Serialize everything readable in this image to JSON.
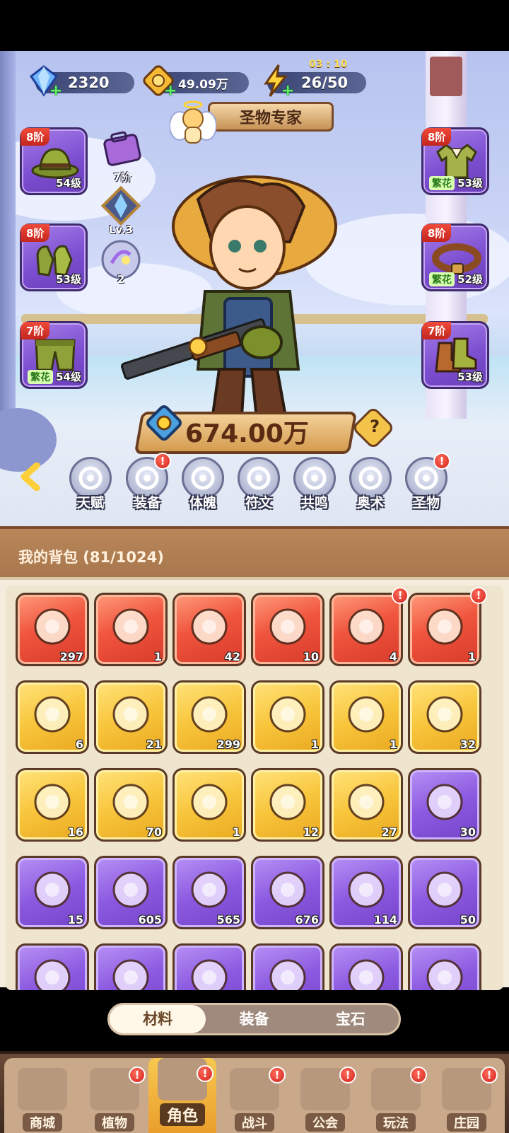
{
  "resources": {
    "gems": "2320",
    "coins": "49.09万",
    "energy": "26/50",
    "energy_timer": "03 : 10"
  },
  "title_banner": "圣物专家",
  "left_slots": [
    {
      "tier": "8阶",
      "level": "54级",
      "tag": "",
      "icon": "hat-icon"
    },
    {
      "tier": "8阶",
      "level": "53级",
      "tag": "",
      "icon": "gloves-icon"
    },
    {
      "tier": "7阶",
      "level": "54级",
      "tag": "繁花",
      "icon": "pants-icon"
    }
  ],
  "right_slots": [
    {
      "tier": "8阶",
      "level": "53级",
      "tag": "繁花",
      "icon": "shirt-icon"
    },
    {
      "tier": "8阶",
      "level": "52级",
      "tag": "繁花",
      "icon": "belt-icon"
    },
    {
      "tier": "7阶",
      "level": "53级",
      "tag": "",
      "icon": "boots-icon"
    }
  ],
  "mini": {
    "bag_label": "7阶",
    "crystal_label": "Lv.3",
    "orb_label": "2"
  },
  "power": "674.00万",
  "features": [
    {
      "label": "天赋",
      "alert": false
    },
    {
      "label": "装备",
      "alert": true
    },
    {
      "label": "体魄",
      "alert": false
    },
    {
      "label": "符文",
      "alert": false
    },
    {
      "label": "共鸣",
      "alert": false
    },
    {
      "label": "奥术",
      "alert": false
    },
    {
      "label": "圣物",
      "alert": true
    }
  ],
  "backpack": {
    "title": "我的背包 (81/1024)",
    "items": [
      {
        "rarity": "red",
        "count": "297",
        "icon": "star-crystal-icon",
        "alert": false
      },
      {
        "rarity": "red",
        "count": "1",
        "icon": "moon-crystal-icon",
        "alert": false
      },
      {
        "rarity": "red",
        "count": "42",
        "icon": "red-potion-icon",
        "alert": false
      },
      {
        "rarity": "red",
        "count": "10",
        "icon": "green-capsule-icon",
        "alert": false
      },
      {
        "rarity": "red",
        "count": "4",
        "icon": "green-vial-icon",
        "alert": true
      },
      {
        "rarity": "red",
        "count": "1",
        "icon": "mystery-chest-icon",
        "alert": true
      },
      {
        "rarity": "gold",
        "count": "6",
        "icon": "key-icon",
        "alert": false
      },
      {
        "rarity": "gold",
        "count": "21",
        "icon": "prism-icon",
        "alert": false
      },
      {
        "rarity": "gold",
        "count": "299",
        "icon": "orange-potion-icon",
        "alert": false
      },
      {
        "rarity": "gold",
        "count": "1",
        "icon": "gold-pile-icon",
        "alert": false
      },
      {
        "rarity": "gold",
        "count": "1",
        "icon": "flower-pot-icon",
        "alert": false
      },
      {
        "rarity": "gold",
        "count": "32",
        "icon": "spell-book-icon",
        "alert": false
      },
      {
        "rarity": "gold",
        "count": "16",
        "icon": "can-icon",
        "alert": false
      },
      {
        "rarity": "gold",
        "count": "70",
        "icon": "owl-sack-icon",
        "alert": false
      },
      {
        "rarity": "gold",
        "count": "1",
        "icon": "thread-spool-icon",
        "alert": false
      },
      {
        "rarity": "gold",
        "count": "12",
        "icon": "glow-flower-icon",
        "alert": false
      },
      {
        "rarity": "gold",
        "count": "27",
        "icon": "rune-knot-icon",
        "alert": false
      },
      {
        "rarity": "purple",
        "count": "30",
        "icon": "purple-potion-icon",
        "alert": false
      },
      {
        "rarity": "purple",
        "count": "15",
        "icon": "hex-badge-icon",
        "alert": false
      },
      {
        "rarity": "purple",
        "count": "605",
        "icon": "green-scroll-icon",
        "alert": false
      },
      {
        "rarity": "purple",
        "count": "565",
        "icon": "pink-scroll-icon",
        "alert": false
      },
      {
        "rarity": "purple",
        "count": "676",
        "icon": "blue-scroll-icon",
        "alert": false
      },
      {
        "rarity": "purple",
        "count": "114",
        "icon": "red-scroll-icon",
        "alert": false
      },
      {
        "rarity": "purple",
        "count": "50",
        "icon": "gold-scroll-icon",
        "alert": false
      },
      {
        "rarity": "purple",
        "count": "",
        "icon": "purple-flask-icon",
        "alert": false
      },
      {
        "rarity": "purple",
        "count": "",
        "icon": "teapot-icon",
        "alert": false
      },
      {
        "rarity": "purple",
        "count": "",
        "icon": "fruit-basket-icon",
        "alert": false
      },
      {
        "rarity": "purple",
        "count": "",
        "icon": "berry-bowl-icon",
        "alert": false
      },
      {
        "rarity": "purple",
        "count": "",
        "icon": "blue-cat-icon",
        "alert": false
      },
      {
        "rarity": "purple",
        "count": "",
        "icon": "amethyst-icon",
        "alert": false
      }
    ]
  },
  "bag_tabs": [
    "材料",
    "装备",
    "宝石"
  ],
  "bag_tab_active": 0,
  "nav": [
    {
      "label": "商城",
      "alert": false,
      "icon": "shop-icon"
    },
    {
      "label": "植物",
      "alert": true,
      "icon": "plant-icon"
    },
    {
      "label": "角色",
      "alert": true,
      "icon": "character-icon"
    },
    {
      "label": "战斗",
      "alert": true,
      "icon": "battle-icon"
    },
    {
      "label": "公会",
      "alert": true,
      "icon": "guild-icon"
    },
    {
      "label": "玩法",
      "alert": true,
      "icon": "modes-icon"
    },
    {
      "label": "庄园",
      "alert": true,
      "icon": "manor-icon"
    }
  ],
  "nav_active": 2,
  "colors": {
    "slot_purple": "#7d4fd1",
    "rarity_red": "#f0553e",
    "rarity_gold": "#f8c53c",
    "rarity_purple": "#8b5ae0",
    "alert_red": "#d1231b"
  }
}
